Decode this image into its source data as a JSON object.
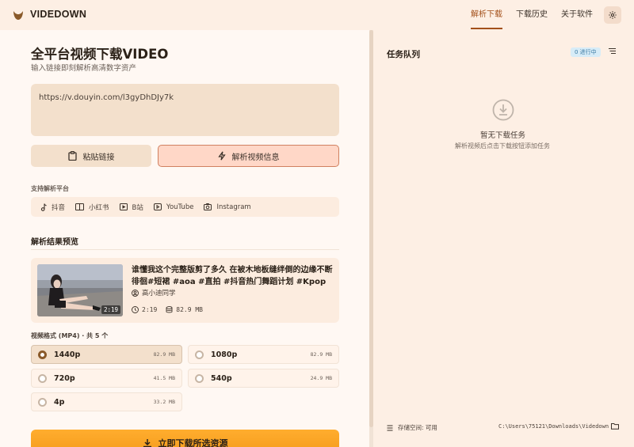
{
  "app": {
    "name": "VIDEDOWN",
    "accent": "#a3501a"
  },
  "nav": {
    "items": [
      {
        "label": "解析下载",
        "active": true
      },
      {
        "label": "下载历史",
        "active": false
      },
      {
        "label": "关于软件",
        "active": false
      }
    ],
    "settings_icon": "gear-icon"
  },
  "main": {
    "title": "全平台视频下载VIDEO",
    "subtitle": "输入链接即刻解析高清数字资产",
    "url_input": {
      "value": "https://v.douyin.com/l3gyDhDJy7k",
      "placeholder": ""
    },
    "paste_button": "粘贴链接",
    "parse_button": "解析视频信息",
    "platforms_label": "支持解析平台",
    "platforms": [
      {
        "label": "抖音",
        "icon": "music-note-icon"
      },
      {
        "label": "小红书",
        "icon": "book-icon"
      },
      {
        "label": "B站",
        "icon": "tv-icon"
      },
      {
        "label": "YouTube",
        "icon": "play-icon"
      },
      {
        "label": "Instagram",
        "icon": "camera-icon"
      }
    ],
    "result_title": "解析结果预览",
    "video": {
      "title": "谁懂我这个完整版剪了多久 在被木地板缝绊倒的边缘不断徘徊#短裙 #aoa #直拍 #抖音热门舞蹈计划 #Kpop",
      "author": "高小迪同学",
      "duration": "2:19",
      "size": "82.9 MB"
    },
    "formats_label": "视频格式 (MP4) · 共 5 个",
    "formats": [
      {
        "quality": "1440p",
        "size": "82.9 MB",
        "selected": true
      },
      {
        "quality": "1080p",
        "size": "82.9 MB",
        "selected": false
      },
      {
        "quality": "720p",
        "size": "41.5 MB",
        "selected": false
      },
      {
        "quality": "540p",
        "size": "24.9 MB",
        "selected": false
      },
      {
        "quality": "4p",
        "size": "33.2 MB",
        "selected": false
      }
    ],
    "download_button": "立即下载所选资源"
  },
  "queue": {
    "title": "任务队列",
    "status": "0 进行中",
    "empty_title": "暂无下载任务",
    "empty_desc": "解析视频后点击下载按钮添加任务",
    "storage_label": "存储空间: 可用",
    "path": "C:\\Users\\75121\\Downloads\\Videdown"
  }
}
